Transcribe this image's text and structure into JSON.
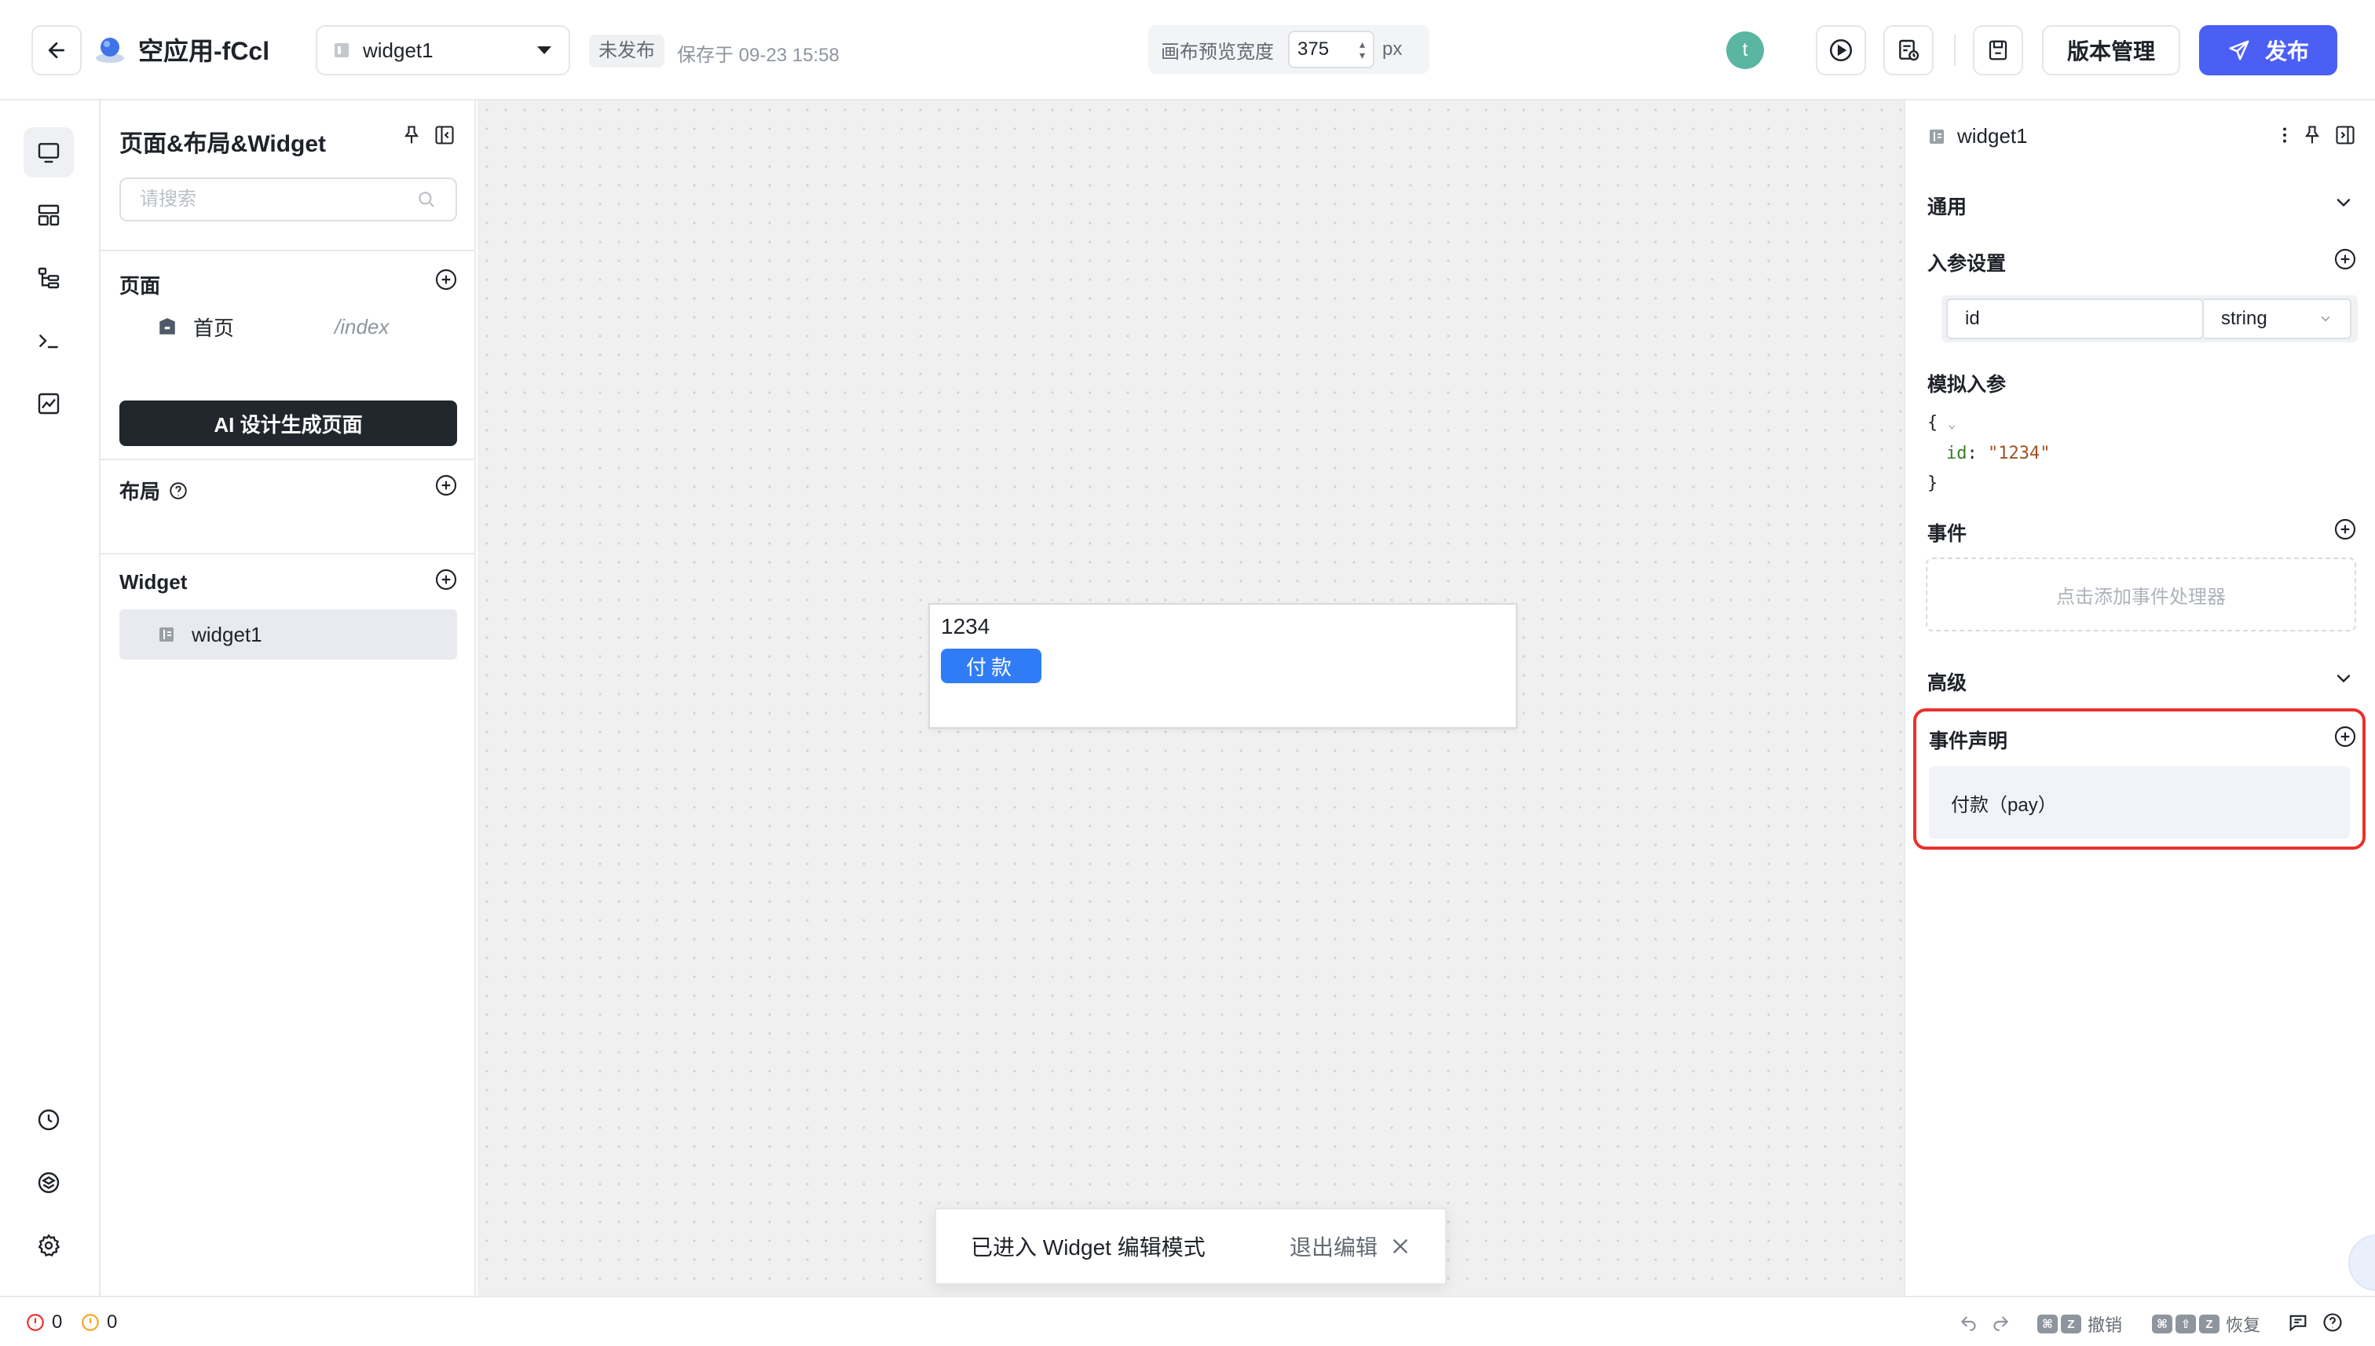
{
  "header": {
    "app_title": "空应用-fCcl",
    "widget_select": "widget1",
    "publish_status": "未发布",
    "saved_at": "保存于 09-23 15:58",
    "canvas_width_label": "画布预览宽度",
    "canvas_width_value": "375",
    "canvas_width_unit": "px",
    "avatar_initial": "t",
    "version_button": "版本管理",
    "publish_button": "发布"
  },
  "left_panel": {
    "title": "页面&布局&Widget",
    "search_placeholder": "请搜索",
    "pages_title": "页面",
    "pages": [
      {
        "name": "首页",
        "path": "/index"
      }
    ],
    "ai_button": "AI 设计生成页面",
    "layout_title": "布局",
    "widget_title": "Widget",
    "widgets": [
      {
        "name": "widget1"
      }
    ]
  },
  "canvas": {
    "widget_value": "1234",
    "pay_button": "付款",
    "toast_message": "已进入 Widget 编辑模式",
    "toast_exit": "退出编辑"
  },
  "right_panel": {
    "widget_name": "widget1",
    "general_title": "通用",
    "params_title": "入参设置",
    "param_name": "id",
    "param_type": "string",
    "mock_title": "模拟入参",
    "mock_open": "{",
    "mock_key": "id",
    "mock_value": "\"1234\"",
    "mock_close": "}",
    "events_title": "事件",
    "events_placeholder": "点击添加事件处理器",
    "advanced_title": "高级",
    "event_decl_title": "事件声明",
    "event_decl_item": "付款（pay）"
  },
  "status_bar": {
    "errors": "0",
    "warnings": "0",
    "undo_label": "撤销",
    "redo_label": "恢复"
  },
  "colors": {
    "accent": "#4c5ff5",
    "pay_button": "#2f7cf6",
    "highlight_border": "#e8322d",
    "error": "#e8322d",
    "warning": "#f5a623"
  }
}
